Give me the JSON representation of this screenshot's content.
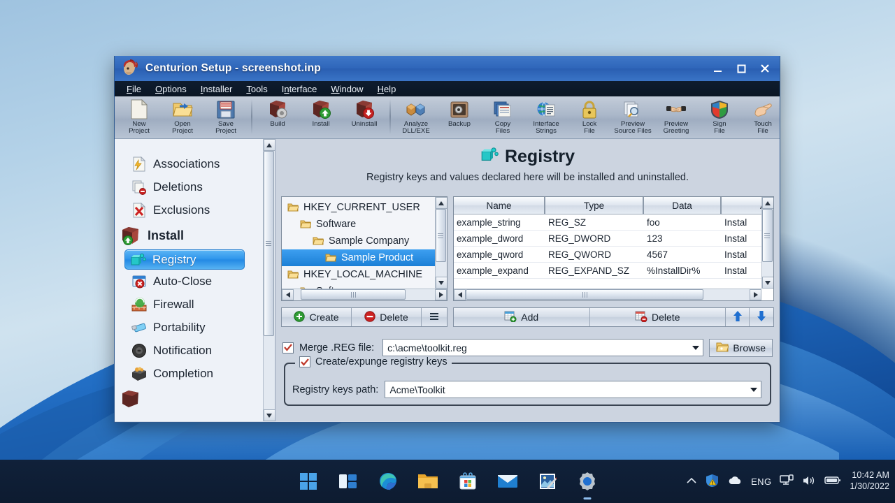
{
  "window": {
    "title": "Centurion Setup - screenshot.inp",
    "app_icon": "centurion-helmet-icon",
    "minimize": "minimize-icon",
    "maximize": "maximize-icon",
    "close": "close-icon"
  },
  "menu": [
    {
      "label": "File",
      "accel": "F"
    },
    {
      "label": "Options",
      "accel": "O"
    },
    {
      "label": "Installer",
      "accel": "I"
    },
    {
      "label": "Tools",
      "accel": "T"
    },
    {
      "label": "Interface",
      "accel": "n"
    },
    {
      "label": "Window",
      "accel": "W"
    },
    {
      "label": "Help",
      "accel": "H"
    }
  ],
  "toolbar": [
    {
      "line1": "New",
      "line2": "Project",
      "icon": "new-document-icon"
    },
    {
      "line1": "Open",
      "line2": "Project",
      "icon": "open-folder-icon"
    },
    {
      "line1": "Save",
      "line2": "Project",
      "icon": "floppy-disk-icon"
    },
    {
      "sep": true
    },
    {
      "line1": "Build",
      "line2": "",
      "icon": "build-box-gear-icon"
    },
    {
      "line1": "Install",
      "line2": "",
      "icon": "install-box-up-icon"
    },
    {
      "line1": "Uninstall",
      "line2": "",
      "icon": "uninstall-box-down-icon"
    },
    {
      "sep": true
    },
    {
      "line1": "Analyze",
      "line2": "DLL/EXE",
      "icon": "analyze-blocks-icon"
    },
    {
      "line1": "Backup",
      "line2": "",
      "icon": "safe-backup-icon"
    },
    {
      "line1": "Copy",
      "line2": "Files",
      "icon": "copy-files-icon"
    },
    {
      "line1": "Interface",
      "line2": "Strings",
      "icon": "globe-document-icon"
    },
    {
      "line1": "Lock",
      "line2": "File",
      "icon": "padlock-icon"
    },
    {
      "line1": "Preview",
      "line2": "Source Files",
      "icon": "preview-magnifier-icon"
    },
    {
      "line1": "Preview",
      "line2": "Greeting",
      "icon": "handshake-icon"
    },
    {
      "line1": "Sign",
      "line2": "File",
      "icon": "shield-sign-icon"
    },
    {
      "line1": "Touch",
      "line2": "File",
      "icon": "hand-touch-icon"
    }
  ],
  "sidebar": {
    "items": [
      {
        "label": "Associations",
        "icon": "associations-lightning-icon",
        "type": "item",
        "selected": false
      },
      {
        "label": "Deletions",
        "icon": "deletions-pages-icon",
        "type": "item",
        "selected": false
      },
      {
        "label": "Exclusions",
        "icon": "exclusions-x-icon",
        "type": "item",
        "selected": false
      },
      {
        "label": "Install",
        "icon": "install-box-up-icon",
        "type": "header",
        "selected": false
      },
      {
        "label": "Registry",
        "icon": "registry-blocks-icon",
        "type": "item",
        "selected": true
      },
      {
        "label": "Auto-Close",
        "icon": "auto-close-window-icon",
        "type": "item",
        "selected": false
      },
      {
        "label": "Firewall",
        "icon": "firewall-brick-icon",
        "type": "item",
        "selected": false
      },
      {
        "label": "Portability",
        "icon": "usb-drive-icon",
        "type": "item",
        "selected": false
      },
      {
        "label": "Notification",
        "icon": "speaker-notification-icon",
        "type": "item",
        "selected": false
      },
      {
        "label": "Completion",
        "icon": "completion-box-icon",
        "type": "item",
        "selected": false
      }
    ],
    "scroll_up_icon": "scroll-up-arrow-icon",
    "scroll_down_icon": "scroll-down-arrow-icon"
  },
  "page": {
    "icon": "registry-blocks-icon",
    "title": "Registry",
    "subtitle": "Registry keys and values declared here will be installed and uninstalled."
  },
  "tree": {
    "nodes": [
      {
        "label": "HKEY_CURRENT_USER",
        "depth": 0,
        "selected": false
      },
      {
        "label": "Software",
        "depth": 1,
        "selected": false
      },
      {
        "label": "Sample Company",
        "depth": 2,
        "selected": false
      },
      {
        "label": "Sample Product",
        "depth": 3,
        "selected": true
      },
      {
        "label": "HKEY_LOCAL_MACHINE",
        "depth": 0,
        "selected": false
      },
      {
        "label": "Software",
        "depth": 1,
        "selected": false
      }
    ],
    "buttons": [
      {
        "label": "Create",
        "icon": "plus-circle-green-icon"
      },
      {
        "label": "Delete",
        "icon": "minus-circle-red-icon"
      },
      {
        "label": "",
        "icon": "hamburger-menu-icon"
      }
    ]
  },
  "listview": {
    "columns": [
      "Name",
      "Type",
      "Data",
      "A"
    ],
    "rows": [
      {
        "name": "example_string",
        "type": "REG_SZ",
        "data": "foo",
        "action": "Instal"
      },
      {
        "name": "example_dword",
        "type": "REG_DWORD",
        "data": "123",
        "action": "Instal"
      },
      {
        "name": "example_qword",
        "type": "REG_QWORD",
        "data": "4567",
        "action": "Instal"
      },
      {
        "name": "example_expand",
        "type": "REG_EXPAND_SZ",
        "data": "%InstallDir%",
        "action": "Instal"
      }
    ],
    "buttons": [
      {
        "label": "Add",
        "icon": "add-row-icon"
      },
      {
        "label": "Delete",
        "icon": "delete-row-icon"
      }
    ],
    "move_up_icon": "move-up-arrow-icon",
    "move_down_icon": "move-down-arrow-icon"
  },
  "merge": {
    "checked": true,
    "label": "Merge .REG file:",
    "value": "c:\\acme\\toolkit.reg",
    "placeholder": "",
    "browse_label": "Browse",
    "browse_icon": "folder-browse-icon",
    "dropdown_icon": "chevron-down-icon"
  },
  "group": {
    "checked": true,
    "legend": "Create/expunge registry keys",
    "field_label": "Registry keys path:",
    "value": "Acme\\Toolkit",
    "placeholder": "",
    "dropdown_icon": "chevron-down-icon"
  },
  "taskbar": {
    "icons": [
      {
        "name": "start-windows-icon",
        "active": false
      },
      {
        "name": "task-view-icon",
        "active": false
      },
      {
        "name": "microsoft-edge-icon",
        "active": false
      },
      {
        "name": "file-explorer-icon",
        "active": false
      },
      {
        "name": "microsoft-store-icon",
        "active": false
      },
      {
        "name": "mail-icon",
        "active": false
      },
      {
        "name": "photos-editor-icon",
        "active": false
      },
      {
        "name": "settings-gear-icon",
        "active": true
      }
    ],
    "tray": {
      "chevron_icon": "show-hidden-icons-chevron",
      "defender_icon": "windows-security-warning-icon",
      "onedrive_icon": "onedrive-cloud-icon",
      "language": "ENG",
      "network_icon": "network-icon",
      "volume_icon": "volume-icon",
      "battery_icon": "battery-icon",
      "time": "10:42 AM",
      "date": "1/30/2022"
    }
  },
  "colors": {
    "titlebar": "#2f66ba",
    "selection": "#1b7fd6",
    "taskbar": "#0d1b30",
    "accent_green": "#2e9b33",
    "accent_red": "#cc2222"
  }
}
